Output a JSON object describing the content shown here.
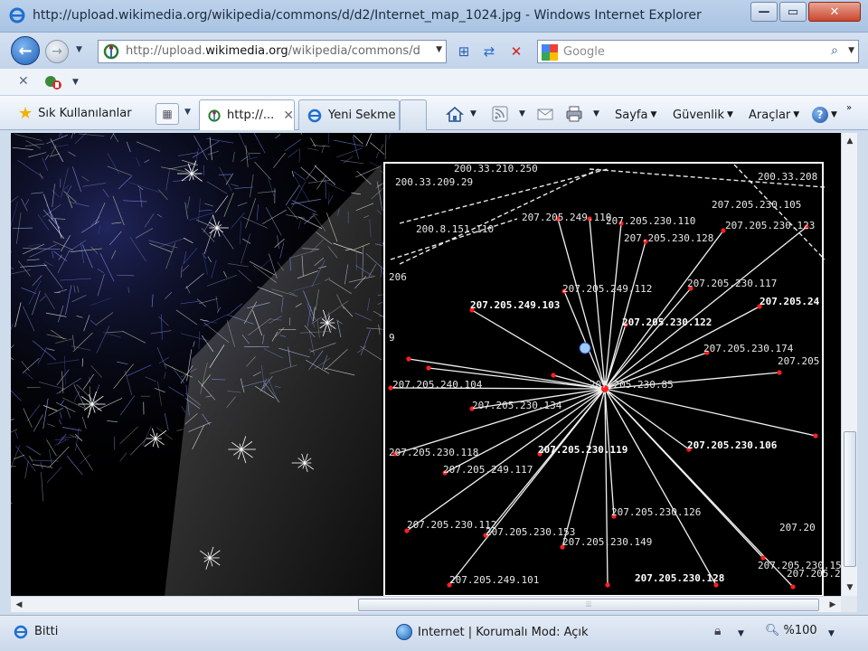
{
  "window": {
    "title": "http://upload.wikimedia.org/wikipedia/commons/d/d2/Internet_map_1024.jpg - Windows Internet Explorer"
  },
  "address": {
    "prefix": "http://upload.",
    "domain": "wikimedia.org",
    "suffix": "/wikipedia/commons/d"
  },
  "search": {
    "placeholder": "Google"
  },
  "favorites": {
    "label": "Sık Kullanılanlar"
  },
  "tabs": [
    {
      "label": "http://...",
      "active": true
    },
    {
      "label": "Yeni Sekme",
      "active": false
    }
  ],
  "commands": {
    "page": "Sayfa",
    "safety": "Güvenlik",
    "tools": "Araçlar"
  },
  "status": {
    "text": "Bitti",
    "zone": "Internet | Korumalı Mod: Açık",
    "zoom": "%100"
  },
  "map": {
    "labels": [
      "200.33.210.250",
      "200.33.209.29",
      "200.33.208",
      "207.205.249.110",
      "207.205.230.110",
      "207.205.230.105",
      "207.205.230.128",
      "207.205.230.123",
      "200.8.151.110",
      "207.205.249.112",
      "207.205.230.117",
      "207.205.249.103",
      "207.205.230.122",
      "207.205.24",
      "207.205.230.174",
      "207.205.240.104",
      "207.205.230.85",
      "207.205",
      "207.205.230.134",
      "207.205.230.118",
      "207.205.230.119",
      "207.205.230.106",
      "207.205.249.117",
      "207.205.230.126",
      "207.205.230.112",
      "207.205.230.153",
      "207.205.230.149",
      "207.205.230.155",
      "207.205.249.101",
      "207.205.230.128",
      "207.205.2",
      "207.20",
      "206",
      "9"
    ]
  },
  "icons": {
    "back": "back-arrow-icon",
    "forward": "forward-arrow-icon",
    "refresh": "refresh-icon",
    "stop": "stop-icon",
    "compat": "compatibility-view-icon",
    "search": "search-magnifier-icon",
    "home": "home-icon",
    "feeds": "feeds-icon",
    "mail": "read-mail-icon",
    "print": "print-icon",
    "help": "help-icon",
    "star": "favorites-star-icon"
  },
  "colors": {
    "accent": "#1f5fb8",
    "close": "#c9472d",
    "node": "#ff2020"
  }
}
